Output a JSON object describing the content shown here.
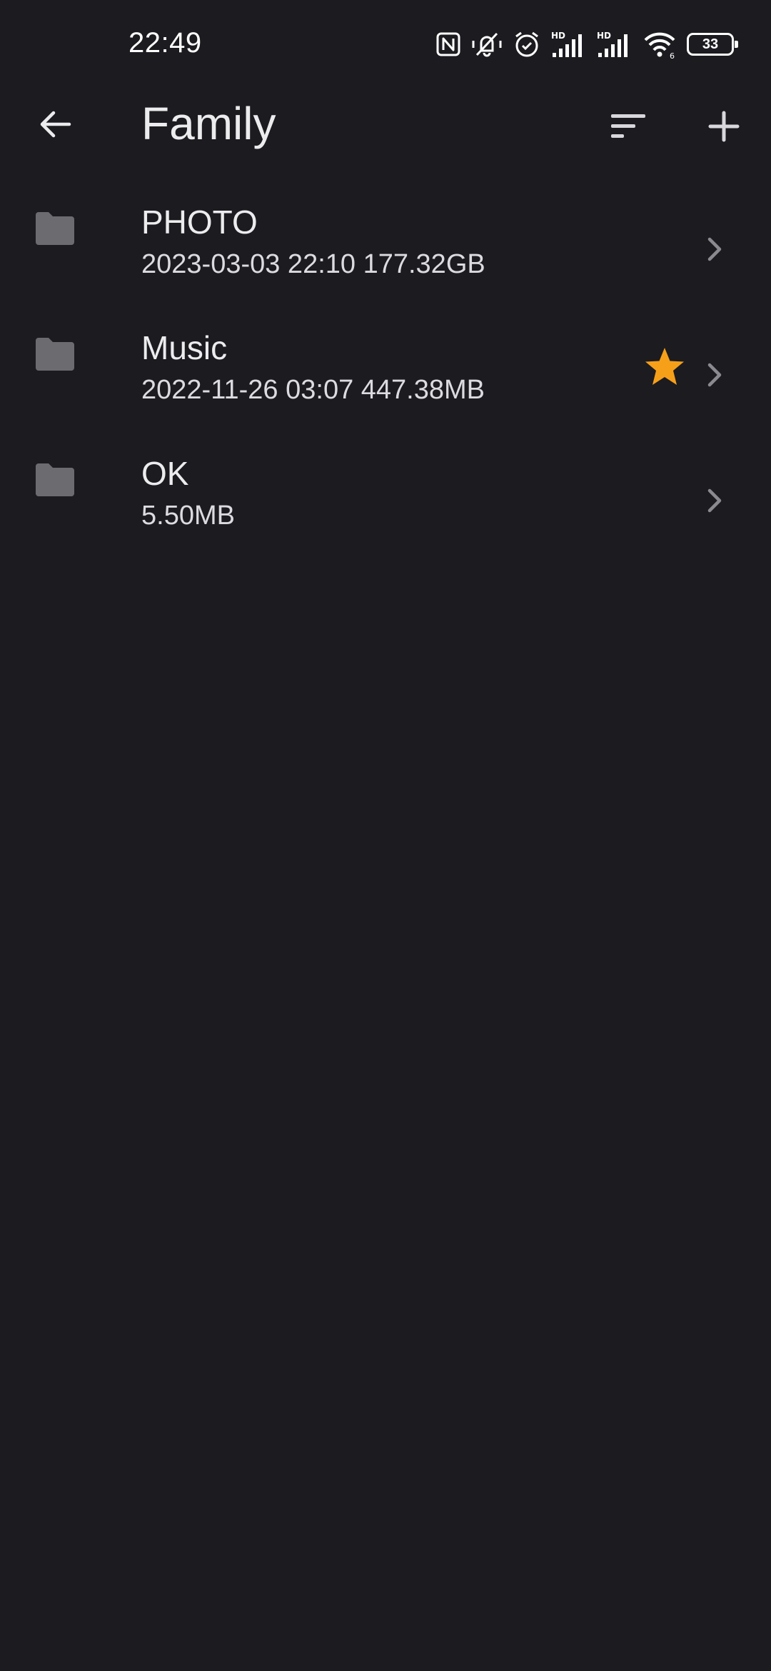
{
  "status_bar": {
    "time": "22:49",
    "icons": [
      "nfc-icon",
      "mute-icon",
      "alarm-icon",
      "signal-hd-icon",
      "signal-hd-icon",
      "wifi-icon",
      "battery-icon"
    ],
    "battery_level": "33",
    "signal_label": "HD"
  },
  "app_bar": {
    "title": "Family",
    "back_icon": "arrow-left-icon",
    "sort_icon": "sort-icon",
    "add_icon": "plus-icon"
  },
  "items": [
    {
      "name": "PHOTO",
      "meta": "2023-03-03 22:10 177.32GB",
      "starred": false
    },
    {
      "name": "Music",
      "meta": "2022-11-26 03:07 447.38MB",
      "starred": true
    },
    {
      "name": "OK",
      "meta": "5.50MB",
      "starred": false
    }
  ],
  "colors": {
    "background": "#1c1b20",
    "text": "#ececee",
    "folder": "#6b6b70",
    "chevron": "#8a8a90",
    "star": "#f6a01a"
  }
}
